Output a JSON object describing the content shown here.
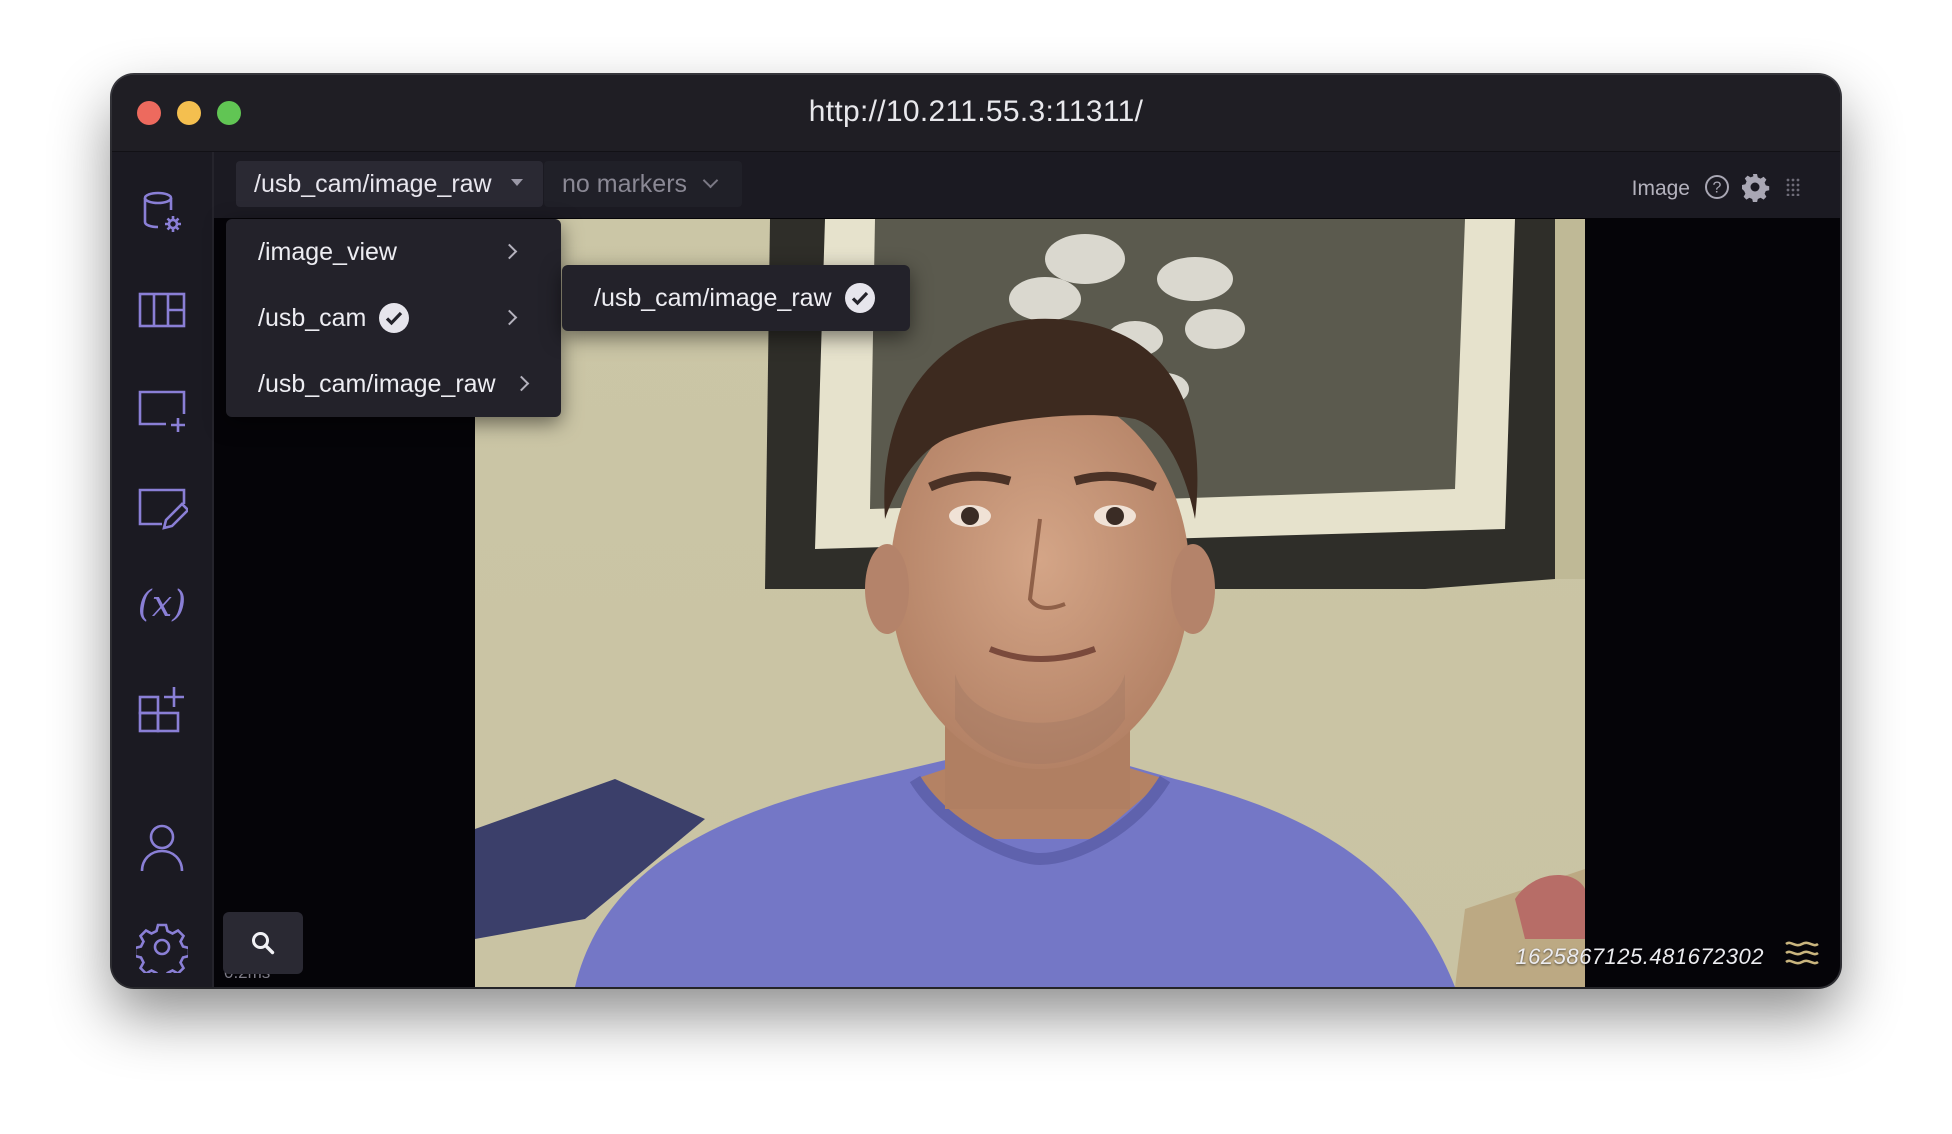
{
  "window": {
    "title": "http://10.211.55.3:11311/"
  },
  "sidebar": {
    "items": [
      {
        "icon": "database-settings-icon"
      },
      {
        "icon": "layout-icon"
      },
      {
        "icon": "add-panel-icon"
      },
      {
        "icon": "edit-panel-icon"
      },
      {
        "icon": "variables-icon"
      },
      {
        "icon": "extensions-icon"
      },
      {
        "icon": "user-icon"
      },
      {
        "icon": "gear-icon"
      }
    ]
  },
  "panel": {
    "topic_dropdown": "/usb_cam/image_raw",
    "markers_dropdown": "no markers",
    "title": "Image"
  },
  "menu": {
    "items": [
      {
        "label": "/image_view",
        "checked": false
      },
      {
        "label": "/usb_cam",
        "checked": true
      },
      {
        "label": "/usb_cam/image_raw",
        "checked": false
      }
    ],
    "submenu": {
      "label": "/usb_cam/image_raw",
      "checked": true
    }
  },
  "overlay": {
    "timestamp": "1625867125.481672302",
    "stats": "0.2ms"
  },
  "colors": {
    "sidebar_icon": "#8a7fd6",
    "menu_bg": "#23222a",
    "titlebar": "#1f1e24"
  }
}
